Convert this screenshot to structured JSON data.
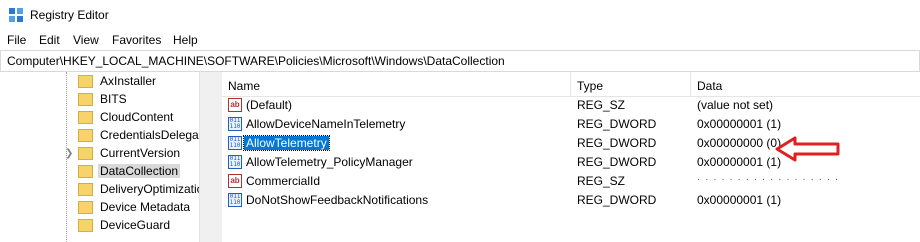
{
  "window": {
    "title": "Registry Editor",
    "icon": "registry-editor-icon"
  },
  "menu": [
    "File",
    "Edit",
    "View",
    "Favorites",
    "Help"
  ],
  "address": "Computer\\HKEY_LOCAL_MACHINE\\SOFTWARE\\Policies\\Microsoft\\Windows\\DataCollection",
  "tree": {
    "items": [
      {
        "label": "AxInstaller"
      },
      {
        "label": "BITS"
      },
      {
        "label": "CloudContent"
      },
      {
        "label": "CredentialsDelegat"
      },
      {
        "label": "CurrentVersion",
        "expandable": true
      },
      {
        "label": "DataCollection",
        "selected": true
      },
      {
        "label": "DeliveryOptimizatic"
      },
      {
        "label": "Device Metadata"
      },
      {
        "label": "DeviceGuard"
      }
    ]
  },
  "list": {
    "columns": {
      "name": "Name",
      "type": "Type",
      "data": "Data"
    },
    "rows": [
      {
        "name": "(Default)",
        "type": "REG_SZ",
        "data": "(value not set)",
        "icon": "string-value-icon"
      },
      {
        "name": "AllowDeviceNameInTelemetry",
        "type": "REG_DWORD",
        "data": "0x00000001 (1)",
        "icon": "dword-value-icon"
      },
      {
        "name": "AllowTelemetry",
        "type": "REG_DWORD",
        "data": "0x00000000 (0)",
        "icon": "dword-value-icon",
        "selected": true
      },
      {
        "name": "AllowTelemetry_PolicyManager",
        "type": "REG_DWORD",
        "data": "0x00000001 (1)",
        "icon": "dword-value-icon"
      },
      {
        "name": "CommercialId",
        "type": "REG_SZ",
        "data": "",
        "icon": "string-value-icon",
        "data_redacted": true
      },
      {
        "name": "DoNotShowFeedbackNotifications",
        "type": "REG_DWORD",
        "data": "0x00000001 (1)",
        "icon": "dword-value-icon"
      }
    ]
  },
  "annotation": {
    "icon": "red-arrow-icon",
    "color": "#e02020"
  },
  "colors": {
    "selection": "#0078d7",
    "tree_selection": "#d9d9d9",
    "folder": "#f6d36b"
  }
}
